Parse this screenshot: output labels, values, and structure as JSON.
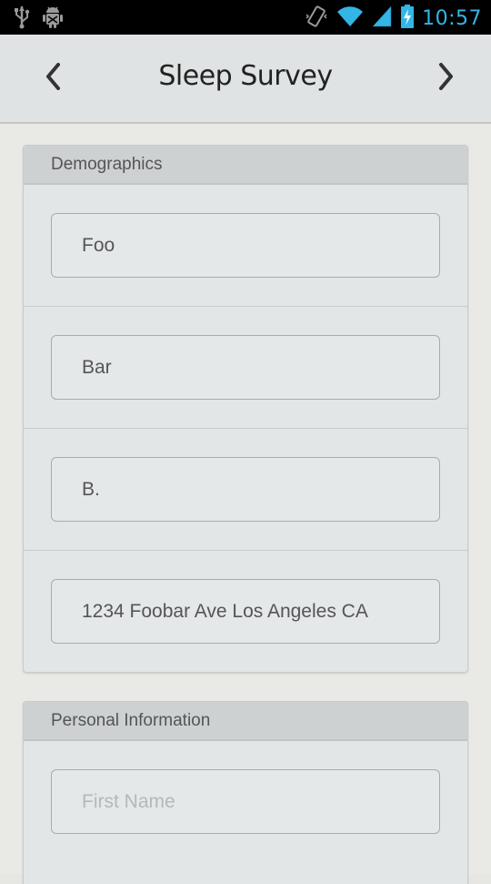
{
  "status_bar": {
    "time": "10:57",
    "icons": [
      "usb-icon",
      "android-debug-icon",
      "vibrate-icon",
      "wifi-icon",
      "signal-icon",
      "battery-charging-icon"
    ]
  },
  "action_bar": {
    "title": "Sleep Survey",
    "prev_icon": "chevron-left-icon",
    "next_icon": "chevron-right-icon"
  },
  "sections": [
    {
      "title": "Demographics",
      "fields": [
        {
          "value": "Foo",
          "placeholder": ""
        },
        {
          "value": "Bar",
          "placeholder": ""
        },
        {
          "value": "B.",
          "placeholder": ""
        },
        {
          "value": "1234 Foobar Ave Los Angeles CA",
          "placeholder": ""
        }
      ]
    },
    {
      "title": "Personal Information",
      "fields": [
        {
          "value": "",
          "placeholder": "First Name"
        }
      ]
    }
  ],
  "colors": {
    "status_accent": "#33b5e5",
    "action_bar_bg": "#e0e3e3",
    "section_header_bg": "#ced1d1",
    "page_bg": "#e9e9e6"
  }
}
